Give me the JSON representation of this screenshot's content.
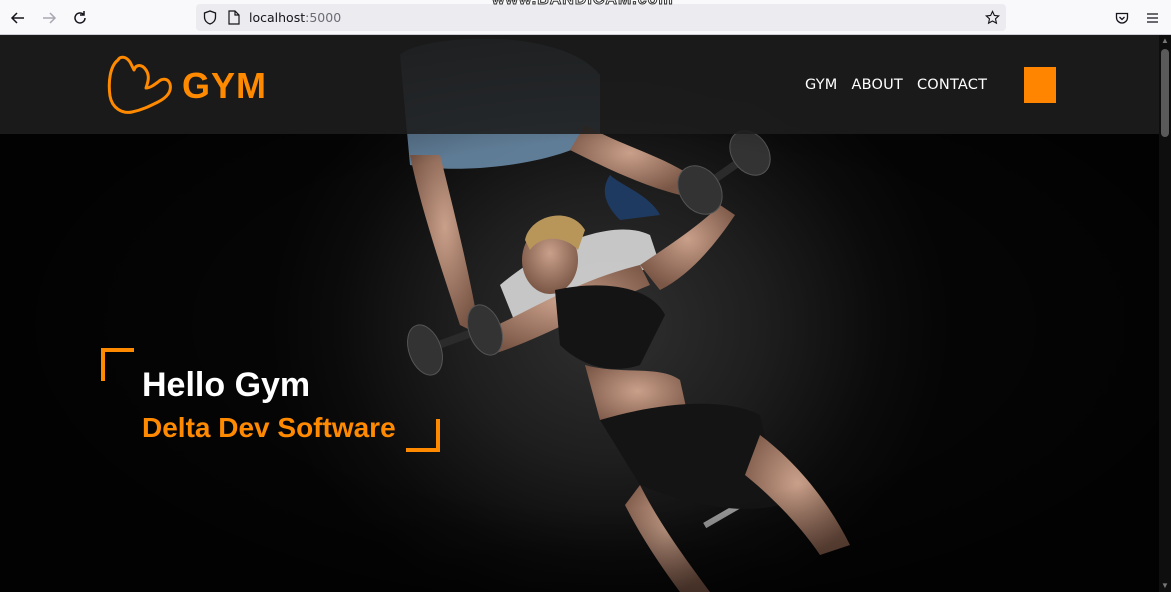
{
  "browser": {
    "url_host": "localhost",
    "url_port": ":5000",
    "watermark": "www.BANDICAM.com"
  },
  "header": {
    "logo_text": "GYM",
    "nav_items": [
      {
        "label": "GYM"
      },
      {
        "label": "ABOUT"
      },
      {
        "label": "CONTACT"
      }
    ]
  },
  "hero": {
    "title": "Hello Gym",
    "subtitle": "Delta Dev Software"
  },
  "colors": {
    "accent": "#ff8a00",
    "header_bg": "#1e1e1e",
    "text": "#ffffff"
  },
  "icons": {
    "back": "arrow-left-icon",
    "forward": "arrow-right-icon",
    "reload": "reload-icon",
    "shield": "shield-icon",
    "page": "page-icon",
    "bookmark": "star-icon",
    "pocket": "pocket-icon",
    "menu": "hamburger-menu-icon",
    "logo": "flexed-arm-icon"
  }
}
